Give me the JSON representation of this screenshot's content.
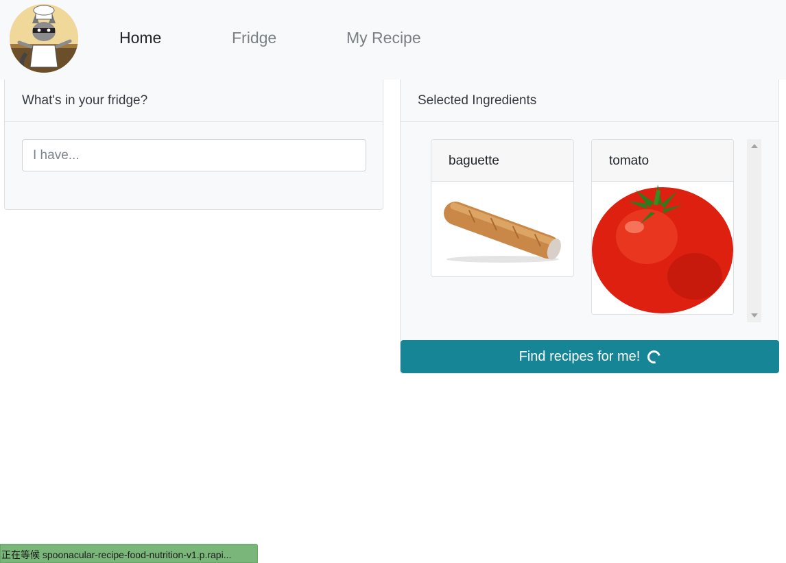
{
  "navbar": {
    "logo_alt": "raccoon chef logo",
    "links": [
      {
        "label": "Home",
        "active": true
      },
      {
        "label": "Fridge",
        "active": false
      },
      {
        "label": "My Recipe",
        "active": false
      }
    ]
  },
  "fridge_panel": {
    "title": "What's in your fridge?",
    "search_placeholder": "I have..."
  },
  "selected_panel": {
    "title": "Selected Ingredients",
    "ingredients": [
      {
        "name": "baguette",
        "image": "baguette-image"
      },
      {
        "name": "tomato",
        "image": "tomato-image"
      }
    ],
    "find_button_label": "Find recipes for me!",
    "loading": true
  },
  "status_bar": {
    "text": "正在等候 spoonacular-recipe-food-nutrition-v1.p.rapi..."
  },
  "colors": {
    "primary_button": "#168596",
    "navbar_bg": "#f8f9fa",
    "status_bar_bg": "#7ab67a"
  }
}
